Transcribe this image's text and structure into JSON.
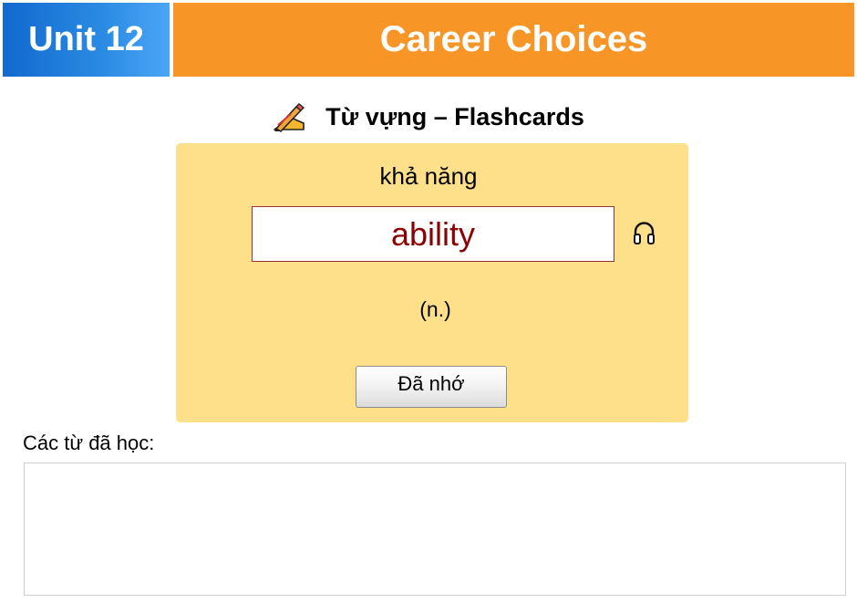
{
  "header": {
    "unit_label": "Unit 12",
    "title": "Career Choices"
  },
  "section": {
    "icon": "writing-hand-icon",
    "title": "Từ vựng – Flashcards"
  },
  "flashcard": {
    "meaning": "khả năng",
    "word": "ability",
    "part_of_speech": "(n.)",
    "audio_icon": "headphones-icon",
    "remember_button": "Đã nhớ"
  },
  "learned": {
    "label": "Các từ đã học:",
    "items": []
  },
  "colors": {
    "unit_blue": "#1169cf",
    "title_orange": "#f79626",
    "card_yellow": "#ffe08a",
    "word_red": "#8b0000"
  }
}
